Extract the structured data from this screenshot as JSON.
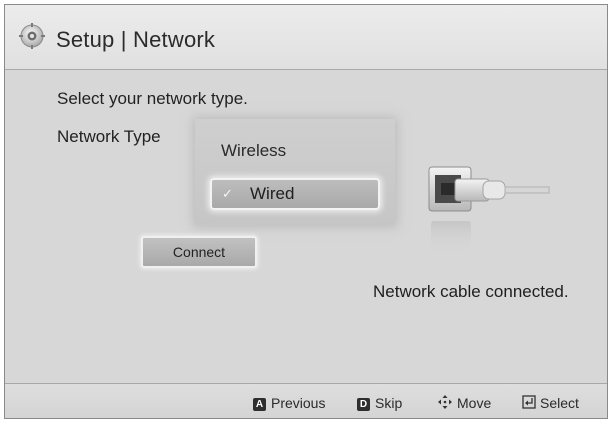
{
  "header": {
    "title": "Setup | Network",
    "icon": "gear-icon"
  },
  "main": {
    "prompt": "Select your network type.",
    "network_type_label": "Network Type",
    "options": [
      {
        "label": "Wireless",
        "selected": false
      },
      {
        "label": "Wired",
        "selected": true,
        "check": "✓"
      }
    ],
    "connect_label": "Connect",
    "status_text": "Network cable connected."
  },
  "footer": {
    "previous": {
      "key": "A",
      "label": "Previous"
    },
    "skip": {
      "key": "D",
      "label": "Skip"
    },
    "move": {
      "label": "Move"
    },
    "select": {
      "label": "Select"
    }
  }
}
